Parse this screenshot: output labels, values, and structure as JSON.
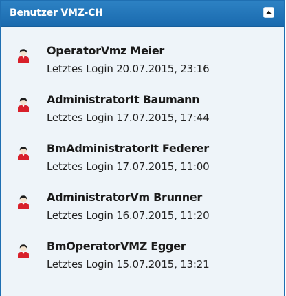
{
  "panel": {
    "title": "Benutzer VMZ-CH",
    "header_color": "#1f74b8",
    "body_color": "#eef4f9"
  },
  "icons": {
    "collapse": "chevron-up-icon",
    "user": "user-icon"
  },
  "users": [
    {
      "name": "OperatorVmz Meier",
      "last_login": "Letztes Login 20.07.2015, 23:16"
    },
    {
      "name": "AdministratorIt Baumann",
      "last_login": "Letztes Login 17.07.2015, 17:44"
    },
    {
      "name": "BmAdministratorIt Federer",
      "last_login": "Letztes Login 17.07.2015, 11:00"
    },
    {
      "name": "AdministratorVm Brunner",
      "last_login": "Letztes Login 16.07.2015, 11:20"
    },
    {
      "name": "BmOperatorVMZ Egger",
      "last_login": "Letztes Login 15.07.2015, 13:21"
    }
  ]
}
